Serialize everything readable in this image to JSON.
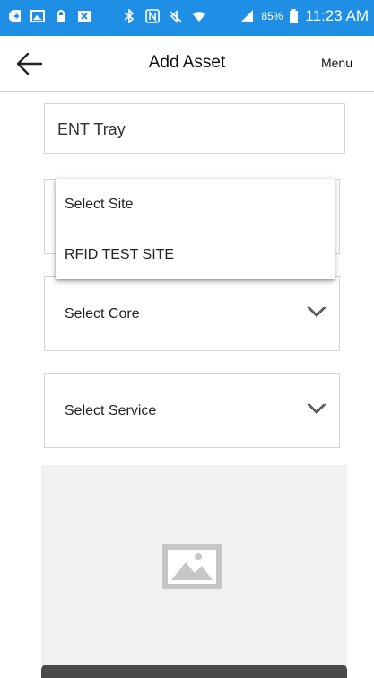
{
  "status_bar": {
    "battery_percent": "85%",
    "time": "11:23 AM",
    "icons": [
      "add-icon",
      "image-icon",
      "lock-icon",
      "close-box-icon",
      "bluetooth-icon",
      "nfc-icon",
      "mute-icon",
      "wifi-icon",
      "signal-icon",
      "battery-icon"
    ]
  },
  "header": {
    "title": "Add Asset",
    "menu_label": "Menu",
    "back_icon": "back-arrow-icon"
  },
  "form": {
    "name_value_prefix": "ENT",
    "name_value_suffix": " Tray",
    "site_dropdown": {
      "options": [
        "Select Site",
        "RFID TEST SITE"
      ]
    },
    "core_select": "Select Core",
    "service_select": "Select Service",
    "image_placeholder_icon": "image-placeholder-icon"
  },
  "colors": {
    "status_bar": "#1f8fe6",
    "border": "#d4d4d4",
    "image_bg": "#f1f1f1",
    "image_icon": "#c6c6c6"
  }
}
